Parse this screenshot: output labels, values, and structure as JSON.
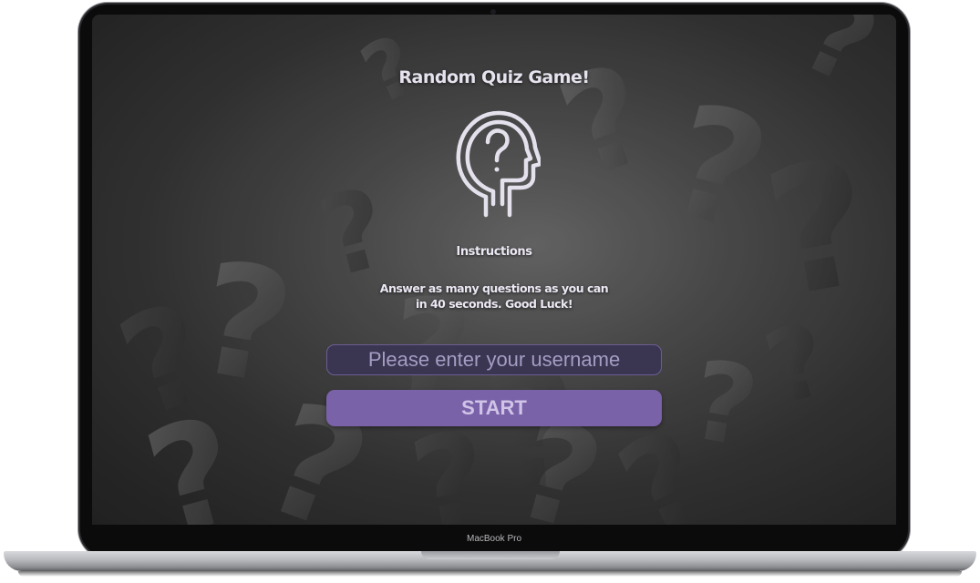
{
  "device": {
    "model_label": "MacBook Pro"
  },
  "app": {
    "title": "Random Quiz Game!",
    "logo_icon": "head-question-icon",
    "instructions_heading": "Instructions",
    "instructions_text": "Answer as many questions as you can in 40 seconds. Good Luck!",
    "username_placeholder": "Please enter your username",
    "username_value": "",
    "start_label": "START"
  },
  "colors": {
    "accent": "#7a62a8",
    "input_bg": "#3a3550",
    "text": "#ece8f4",
    "background": "#4a4a4a"
  }
}
